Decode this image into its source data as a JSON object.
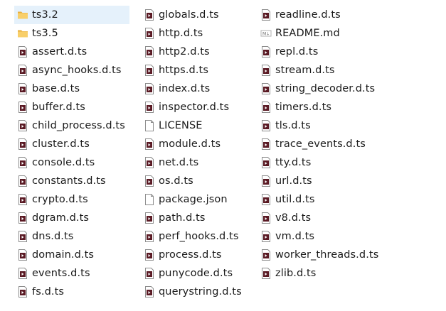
{
  "columns": [
    [
      {
        "name": "ts3.2",
        "type": "folder",
        "selected": true
      },
      {
        "name": "ts3.5",
        "type": "folder"
      },
      {
        "name": "assert.d.ts",
        "type": "ts-file"
      },
      {
        "name": "async_hooks.d.ts",
        "type": "ts-file"
      },
      {
        "name": "base.d.ts",
        "type": "ts-file"
      },
      {
        "name": "buffer.d.ts",
        "type": "ts-file"
      },
      {
        "name": "child_process.d.ts",
        "type": "ts-file"
      },
      {
        "name": "cluster.d.ts",
        "type": "ts-file"
      },
      {
        "name": "console.d.ts",
        "type": "ts-file"
      },
      {
        "name": "constants.d.ts",
        "type": "ts-file"
      },
      {
        "name": "crypto.d.ts",
        "type": "ts-file"
      },
      {
        "name": "dgram.d.ts",
        "type": "ts-file"
      },
      {
        "name": "dns.d.ts",
        "type": "ts-file"
      },
      {
        "name": "domain.d.ts",
        "type": "ts-file"
      },
      {
        "name": "events.d.ts",
        "type": "ts-file"
      },
      {
        "name": "fs.d.ts",
        "type": "ts-file"
      }
    ],
    [
      {
        "name": "globals.d.ts",
        "type": "ts-file"
      },
      {
        "name": "http.d.ts",
        "type": "ts-file"
      },
      {
        "name": "http2.d.ts",
        "type": "ts-file"
      },
      {
        "name": "https.d.ts",
        "type": "ts-file"
      },
      {
        "name": "index.d.ts",
        "type": "ts-file"
      },
      {
        "name": "inspector.d.ts",
        "type": "ts-file"
      },
      {
        "name": "LICENSE",
        "type": "plain-file"
      },
      {
        "name": "module.d.ts",
        "type": "ts-file"
      },
      {
        "name": "net.d.ts",
        "type": "ts-file"
      },
      {
        "name": "os.d.ts",
        "type": "ts-file"
      },
      {
        "name": "package.json",
        "type": "plain-file"
      },
      {
        "name": "path.d.ts",
        "type": "ts-file"
      },
      {
        "name": "perf_hooks.d.ts",
        "type": "ts-file"
      },
      {
        "name": "process.d.ts",
        "type": "ts-file"
      },
      {
        "name": "punycode.d.ts",
        "type": "ts-file"
      },
      {
        "name": "querystring.d.ts",
        "type": "ts-file"
      }
    ],
    [
      {
        "name": "readline.d.ts",
        "type": "ts-file"
      },
      {
        "name": "README.md",
        "type": "md-file"
      },
      {
        "name": "repl.d.ts",
        "type": "ts-file"
      },
      {
        "name": "stream.d.ts",
        "type": "ts-file"
      },
      {
        "name": "string_decoder.d.ts",
        "type": "ts-file"
      },
      {
        "name": "timers.d.ts",
        "type": "ts-file"
      },
      {
        "name": "tls.d.ts",
        "type": "ts-file"
      },
      {
        "name": "trace_events.d.ts",
        "type": "ts-file"
      },
      {
        "name": "tty.d.ts",
        "type": "ts-file"
      },
      {
        "name": "url.d.ts",
        "type": "ts-file"
      },
      {
        "name": "util.d.ts",
        "type": "ts-file"
      },
      {
        "name": "v8.d.ts",
        "type": "ts-file"
      },
      {
        "name": "vm.d.ts",
        "type": "ts-file"
      },
      {
        "name": "worker_threads.d.ts",
        "type": "ts-file"
      },
      {
        "name": "zlib.d.ts",
        "type": "ts-file"
      }
    ]
  ],
  "icons": {
    "folder": "folder-icon",
    "ts-file": "typescript-file-icon",
    "plain-file": "blank-file-icon",
    "md-file": "markdown-file-icon"
  },
  "colors": {
    "selection": "#e5f1fb",
    "folder": "#f4c55b",
    "ts_icon_accent": "#7a1f2b"
  }
}
